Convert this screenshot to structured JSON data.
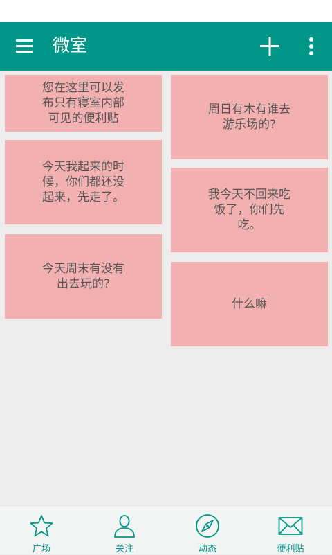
{
  "app_bar": {
    "title": "微室",
    "menu_icon": "hamburger-menu-icon",
    "add_icon": "plus-icon",
    "more_icon": "vertical-dots-icon",
    "background": "#009688"
  },
  "notes": [
    {
      "text": "您在这里可以发布只有寝室内部可见的便利贴",
      "color": "#f2b0b0"
    },
    {
      "text": "周日有木有谁去游乐场的?",
      "color": "#f2b0b0"
    },
    {
      "text": "今天我起来的时候，你们都还没起来，先走了。",
      "color": "#f2b0b0"
    },
    {
      "text": "我今天不回来吃饭了，你们先吃。",
      "color": "#f2b0b0"
    },
    {
      "text": "今天周末有没有出去玩的?",
      "color": "#f2b0b0"
    },
    {
      "text": "什么嘛",
      "color": "#f2b0b0"
    }
  ],
  "bottom_nav": {
    "accent": "#009688",
    "items": [
      {
        "label": "广场",
        "icon": "star-icon"
      },
      {
        "label": "关注",
        "icon": "person-icon"
      },
      {
        "label": "动态",
        "icon": "compass-icon"
      },
      {
        "label": "便利贴",
        "icon": "envelope-icon"
      }
    ]
  }
}
